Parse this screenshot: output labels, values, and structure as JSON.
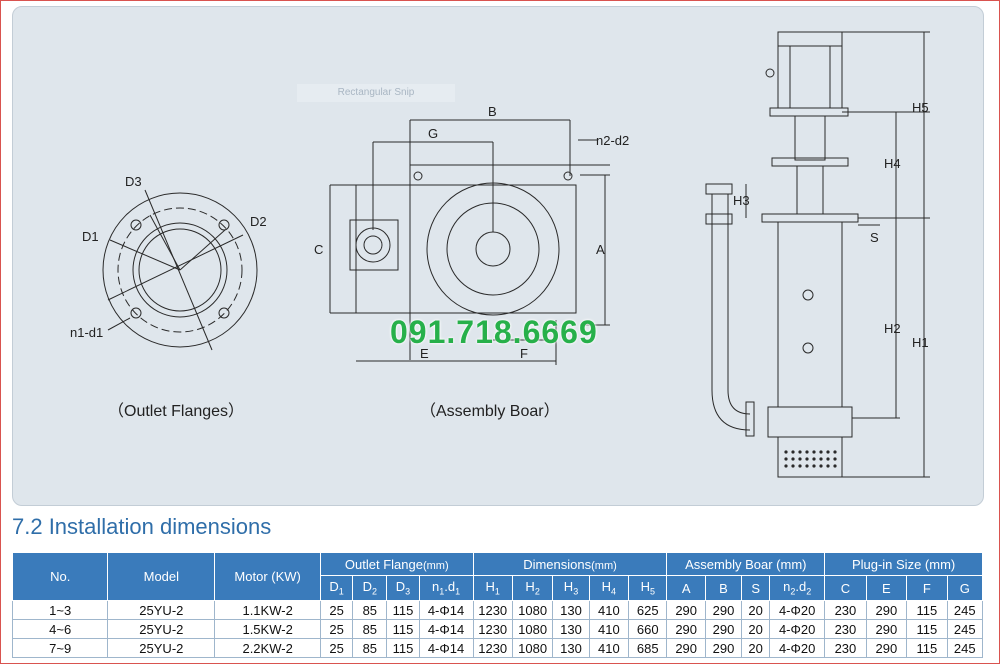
{
  "watermark": "Rectangular Snip",
  "phone": "091.718.6669",
  "captions": {
    "outlet": "（Outlet Flanges）",
    "assembly": "（Assembly Boar）"
  },
  "flange_labels": {
    "d3": "D3",
    "d2": "D2",
    "d1": "D1",
    "n1d1": "n1-d1"
  },
  "board_labels": {
    "b": "B",
    "g": "G",
    "n2d2": "n2-d2",
    "c": "C",
    "a": "A",
    "e": "E",
    "f": "F"
  },
  "pump_labels": {
    "h5": "H5",
    "h4": "H4",
    "h3": "H3",
    "s": "S",
    "h2": "H2",
    "h1": "H1"
  },
  "section_title": "7.2 Installation dimensions",
  "table": {
    "groups": {
      "no": "No.",
      "model": "Model",
      "motor": "Motor (KW)",
      "outlet": "Outlet Flange",
      "outlet_unit": "(mm)",
      "dims": "Dimensions",
      "dims_unit": "(mm)",
      "assembly": "Assembly Boar (mm)",
      "plugin": "Plug-in Size (mm)"
    },
    "subheads": [
      "D1",
      "D2",
      "D3",
      "n1.d1",
      "H1",
      "H2",
      "H3",
      "H4",
      "H5",
      "A",
      "B",
      "S",
      "n2.d2",
      "C",
      "E",
      "F",
      "G"
    ],
    "rows": [
      [
        "1~3",
        "25YU-2",
        "1.1KW-2",
        "25",
        "85",
        "115",
        "4-Φ14",
        "1230",
        "1080",
        "130",
        "410",
        "625",
        "290",
        "290",
        "20",
        "4-Φ20",
        "230",
        "290",
        "115",
        "245"
      ],
      [
        "4~6",
        "25YU-2",
        "1.5KW-2",
        "25",
        "85",
        "115",
        "4-Φ14",
        "1230",
        "1080",
        "130",
        "410",
        "660",
        "290",
        "290",
        "20",
        "4-Φ20",
        "230",
        "290",
        "115",
        "245"
      ],
      [
        "7~9",
        "25YU-2",
        "2.2KW-2",
        "25",
        "85",
        "115",
        "4-Φ14",
        "1230",
        "1080",
        "130",
        "410",
        "685",
        "290",
        "290",
        "20",
        "4-Φ20",
        "230",
        "290",
        "115",
        "245"
      ]
    ]
  },
  "colors": {
    "header": "#3a7bbb",
    "title": "#2f6ea9",
    "phone": "#27b04a",
    "panel": "#dfe6ec"
  }
}
